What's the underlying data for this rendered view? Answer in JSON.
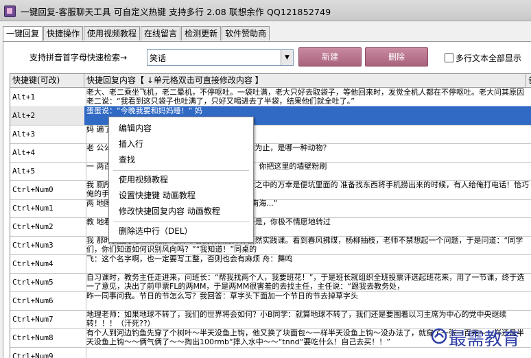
{
  "window": {
    "title": "一键回复-客服聊天工具  可自定义热键  支持多行  2.08    联想余作   QQ121852749"
  },
  "tabs": [
    "一键回复",
    "快捷操作",
    "使用视频教程",
    "在线留言",
    "检测更新",
    "软件赞助商"
  ],
  "toolbar": {
    "search_label": "支持拼音首字母快速检索→",
    "search_value": "笑话",
    "new_label": "新建",
    "delete_label": "删除",
    "multiline_label": "多行文本全部显示"
  },
  "grid": {
    "columns": [
      "快捷键(可改)",
      "快捷回复内容【 ↓单元格双击可直接修改内容 】",
      "备"
    ],
    "rows": [
      {
        "key": "Alt+1",
        "content": "老大、老二乘坐飞机，老二晕机，不停呕吐。一袋吐满，老大只好去取袋子，等他回来时，发觉全机人都在不停呕吐。老大问其原因老二说：“我看到这只袋子也吐满了，只好又喝进去了半袋，结果他们就全吐了。”"
      },
      {
        "key": "Alt+2",
        "content": "蛋蛋说：“今晚我要和妈妈睡！”  妈"
      },
      {
        "key": "Alt+3",
        "content": "妈                                                            遍了！”                     穿的。”？"
      },
      {
        "key": "Alt+4",
        "content": "老                                                            公公出来时，它都会叫你起床，而且叫到你起床为止，是哪一种动物？"
      },
      {
        "key": "Alt+5",
        "content": "一                                                            两百元，我会为你做任何事情。”店主说：“好啊，你把这里的墙壁粉刷"
      },
      {
        "key": "Ctrl+Num0",
        "content": "我                                                            厕所的时候不小心把手机掉到便坑里去了。不幸之中的万幸是便坑里面的                                                            准备找东西将手机捞出来的时候，有人给俺打电话！恰巧俺的手机又调的是"
      },
      {
        "key": "Ctrl+Num1",
        "content": "两                                                            地图，甲：“我们先杀到天安门，然后再杀到中南海...”"
      },
      {
        "key": "Ctrl+Num2",
        "content": "教                                                            地看着教练，教练又大声说了一便：“报数！”于是，你极不情愿地转过"
      },
      {
        "key": "Ctrl+Num3",
        "content": "我                                                            那时我上小学一年级，老师带着我们去野外作自然实践课。看到春风拂煤，杨柳抽枝，老师不禁想起一个问题，于是问道：“同学们，你们知道如何识别风向吗？”“我知道！”同桌的"
      },
      {
        "key": "Ctrl+Num4",
        "content": "飞：这个名字啊，也一定要写工整，否则也会有麻烦  舟：舞鸣"
      },
      {
        "key": "Ctrl+Num5",
        "content": "自习课时，教务主任走进来，问班长：“帮我找两个人，我要班花！”，于是班长就组织全班投票评选起班花来，用了一节课，终于选一了意见，决出了前甲票FL的两MM，于是两MM很害羞的去找主任，主任说：“跟我去教务处，"
      },
      {
        "key": "Ctrl+Num6",
        "content": "昨一同事问我。节日的节怎么写？我回答：草字头下面加一个节日的节去掉草字头"
      },
      {
        "key": "Ctrl+Num7",
        "content": "地理老师：如果地球不转了，我们的世界将会如何？小B同学：就算地球不转了，我们还是要围着以习主席为中心的党中央继续转！！！（汗死??）"
      },
      {
        "key": "Ctrl+Num8",
        "content": "有个人到河边钓鱼先穿了个树叶～半天没鱼上钩，他又换了块面包～一样半天没鱼上钩～没办法了，就穿了一张一百元～一样还是半天没鱼上钩～～俩气俩了～～掏出100rmb“摔入水中～～“tnnd“要吃什么！自己去买！！”"
      },
      {
        "key": "Ctrl+Num9",
        "content": ""
      }
    ]
  },
  "context_menu": {
    "items": [
      "编辑内容",
      "插入行",
      "查找",
      "使用视频教程",
      "设置快捷键 动画教程",
      "修改快捷回复内容 动画教程",
      "删除选中行（DEL）"
    ]
  },
  "watermark": {
    "text": "最需教育"
  }
}
